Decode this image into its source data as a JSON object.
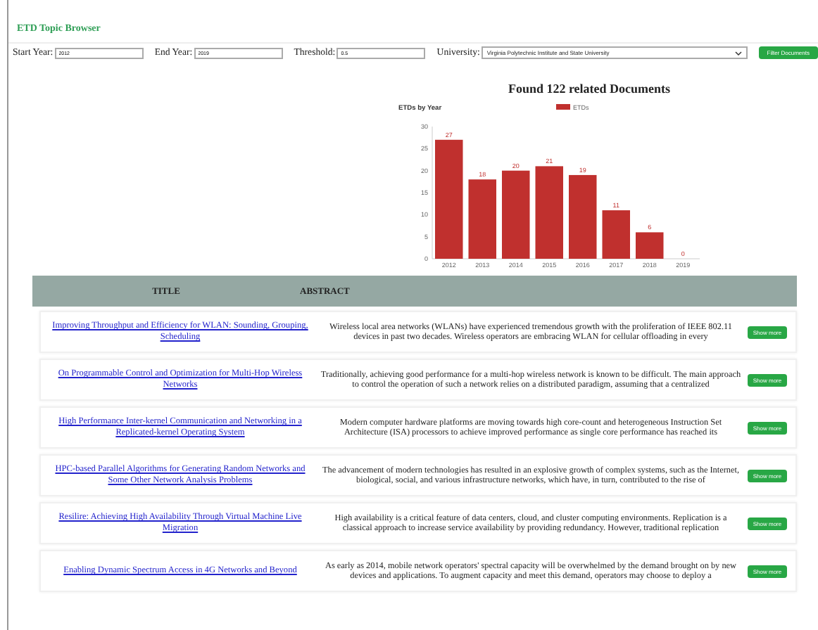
{
  "app_title": "ETD Topic Browser",
  "filters": {
    "start_year": {
      "label": "Start Year:",
      "value": "2012"
    },
    "end_year": {
      "label": "End Year:",
      "value": "2019"
    },
    "threshold": {
      "label": "Threshold:",
      "value": "0.5"
    },
    "university": {
      "label": "University:",
      "value": "Virginia Polytechnic Institute and State University"
    },
    "button": "Filter Documents"
  },
  "results_heading": "Found 122 related Documents",
  "chart": {
    "chart_data": {
      "type": "bar",
      "title": "ETDs by Year",
      "categories": [
        "2012",
        "2013",
        "2014",
        "2015",
        "2016",
        "2017",
        "2018",
        "2019"
      ],
      "series": [
        {
          "name": "ETDs",
          "color": "#c0302e",
          "values": [
            27,
            18,
            20,
            21,
            19,
            11,
            6,
            0
          ]
        }
      ],
      "ylim": [
        0,
        30
      ],
      "yticks": [
        0,
        5,
        10,
        15,
        20,
        25,
        30
      ],
      "data_labels": true
    }
  },
  "table": {
    "columns": [
      "TITLE",
      "ABSTRACT"
    ],
    "rows": [
      {
        "title": "Improving Throughput and Efficiency for WLAN: Sounding, Grouping, Scheduling",
        "abstract": "Wireless local area networks (WLANs) have experienced tremendous growth with the proliferation of IEEE 802.11 devices in past two decades. Wireless operators are embracing WLAN for cellular offloading in every",
        "action": "Show more"
      },
      {
        "title": "On Programmable Control and Optimization for Multi-Hop Wireless Networks",
        "abstract": "Traditionally, achieving good performance for a multi-hop wireless network is known to be difficult. The main approach to control the operation of such a network relies on a distributed paradigm, assuming that a centralized",
        "action": "Show more"
      },
      {
        "title": "High Performance Inter-kernel Communication and Networking in a Replicated-kernel Operating System",
        "abstract": "Modern computer hardware platforms are moving towards high core-count and heterogeneous Instruction Set Architecture (ISA) processors to achieve improved performance as single core performance has reached its",
        "action": "Show more"
      },
      {
        "title": "HPC-based Parallel Algorithms for Generating Random Networks and Some Other Network Analysis Problems",
        "abstract": "The advancement of modern technologies has resulted in an explosive growth of complex systems, such as the Internet, biological, social, and various infrastructure networks, which have, in turn, contributed to the rise of",
        "action": "Show more"
      },
      {
        "title": "Resilire: Achieving High Availability Through Virtual Machine Live Migration",
        "abstract": "High availability is a critical feature of data centers, cloud, and cluster computing environments. Replication is a classical approach to increase service availability by providing redundancy. However, traditional replication",
        "action": "Show more"
      },
      {
        "title": "Enabling Dynamic Spectrum Access in 4G Networks and Beyond",
        "abstract": "As early as 2014, mobile network operators' spectral capacity will be overwhelmed by the demand brought on by new devices and applications. To augment capacity and meet this demand, operators may choose to deploy a",
        "action": "Show more"
      }
    ]
  }
}
